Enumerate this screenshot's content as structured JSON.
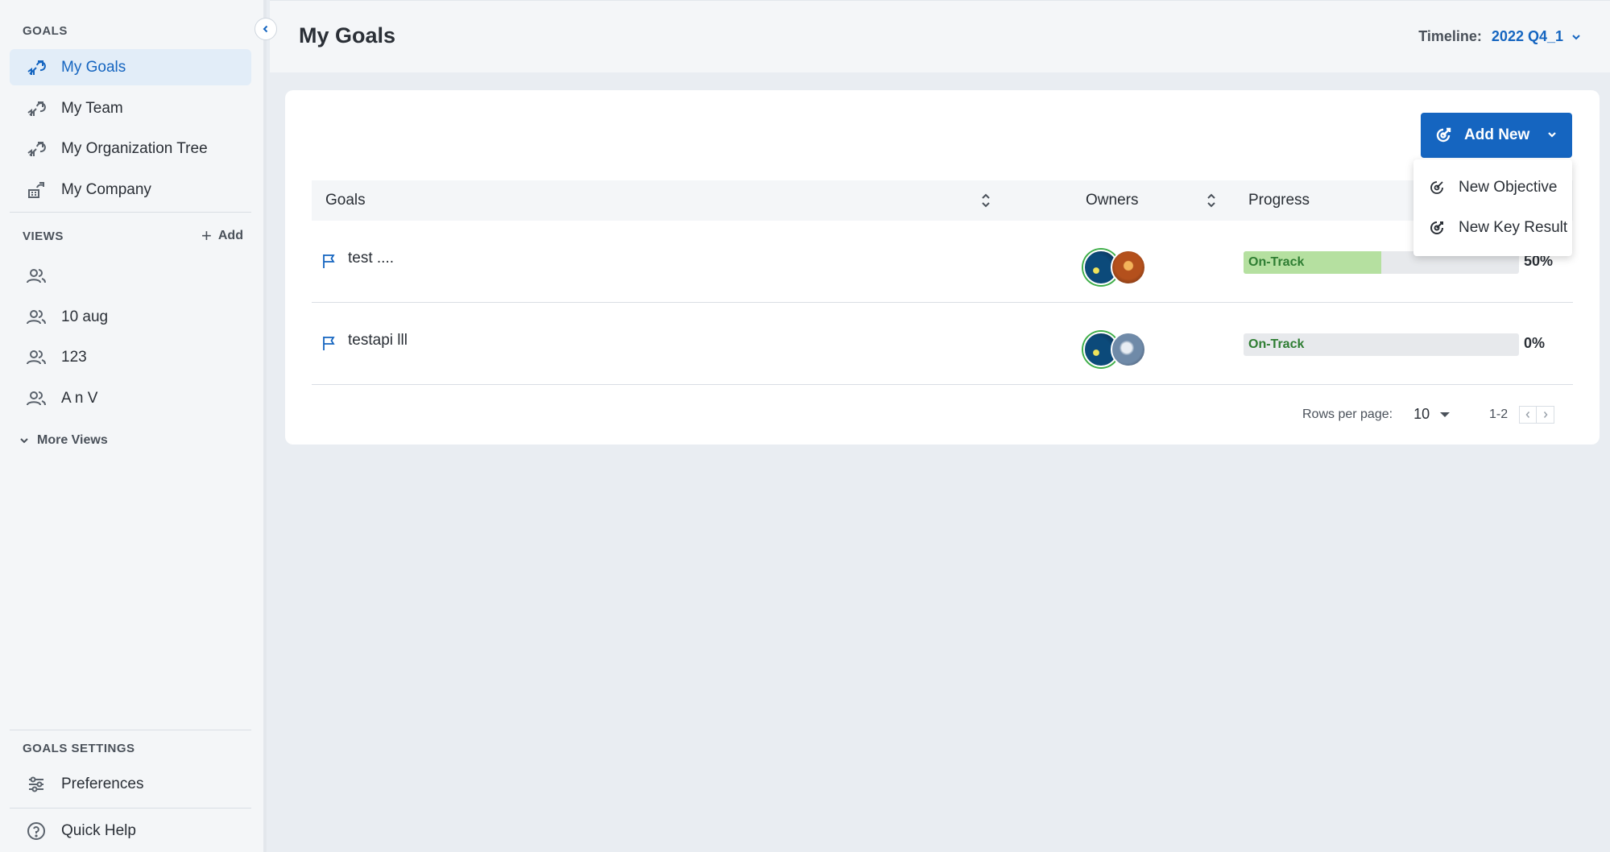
{
  "sidebar": {
    "goals_section": "GOALS",
    "goals_items": [
      {
        "label": "My Goals",
        "icon": "goals-icon",
        "active": true
      },
      {
        "label": "My Team",
        "icon": "team-goals-icon"
      },
      {
        "label": "My Organization Tree",
        "icon": "org-tree-icon"
      },
      {
        "label": "My Company",
        "icon": "company-icon"
      }
    ],
    "views_section": "VIEWS",
    "add_view_label": "Add",
    "views": [
      {
        "label": "",
        "icon": "people-icon"
      },
      {
        "label": "10 aug",
        "icon": "people-icon"
      },
      {
        "label": "123",
        "icon": "people-icon"
      },
      {
        "label": "A n V",
        "icon": "people-icon"
      }
    ],
    "more_views_label": "More Views",
    "settings_section": "GOALS SETTINGS",
    "preferences_label": "Preferences",
    "quick_help_label": "Quick Help"
  },
  "header": {
    "title": "My Goals",
    "timeline_label": "Timeline:",
    "timeline_value": "2022 Q4_1"
  },
  "toolbar": {
    "add_new_label": "Add New",
    "menu": [
      {
        "label": "New Objective",
        "icon": "objective-icon"
      },
      {
        "label": "New Key Result",
        "icon": "key-result-icon"
      }
    ]
  },
  "table": {
    "columns": [
      "Goals",
      "Owners",
      "Progress"
    ],
    "rows": [
      {
        "name": "test ....",
        "status": "On-Track",
        "progress_fraction": 0.5,
        "percent": "50%"
      },
      {
        "name": "testapi lll",
        "status": "On-Track",
        "progress_fraction": 0.0,
        "percent": "0%"
      }
    ]
  },
  "pagination": {
    "rows_per_page_label": "Rows per page:",
    "rows_per_page_value": "10",
    "range": "1-2"
  },
  "colors": {
    "accent": "#1565c0",
    "on_track_fill": "#b5e0a0",
    "on_track_text": "#2e7d32"
  }
}
